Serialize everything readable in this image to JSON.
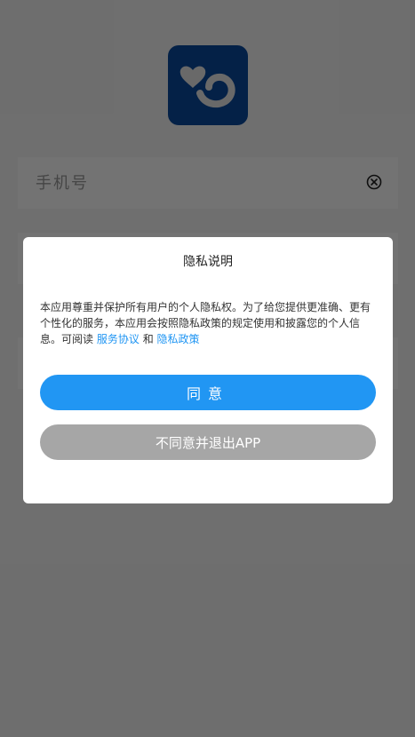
{
  "login": {
    "phone_placeholder": "手机号",
    "logo_icon": "app-logo-heart-icon",
    "clear_icon": "clear-circle-x-icon"
  },
  "dialog": {
    "title": "隐私说明",
    "body_text": "本应用尊重并保护所有用户的个人隐私权。为了给您提供更准确、更有个性化的服务，本应用会按照隐私政策的规定使用和披露您的个人信息。可阅读",
    "link_service": "服务协议",
    "conjunction": "和",
    "link_privacy": "隐私政策",
    "agree_label": "同意",
    "disagree_label": "不同意并退出APP"
  },
  "colors": {
    "brand": "#0a4a9e",
    "accent": "#2196f3",
    "disabled_button": "#a6a6a6"
  }
}
